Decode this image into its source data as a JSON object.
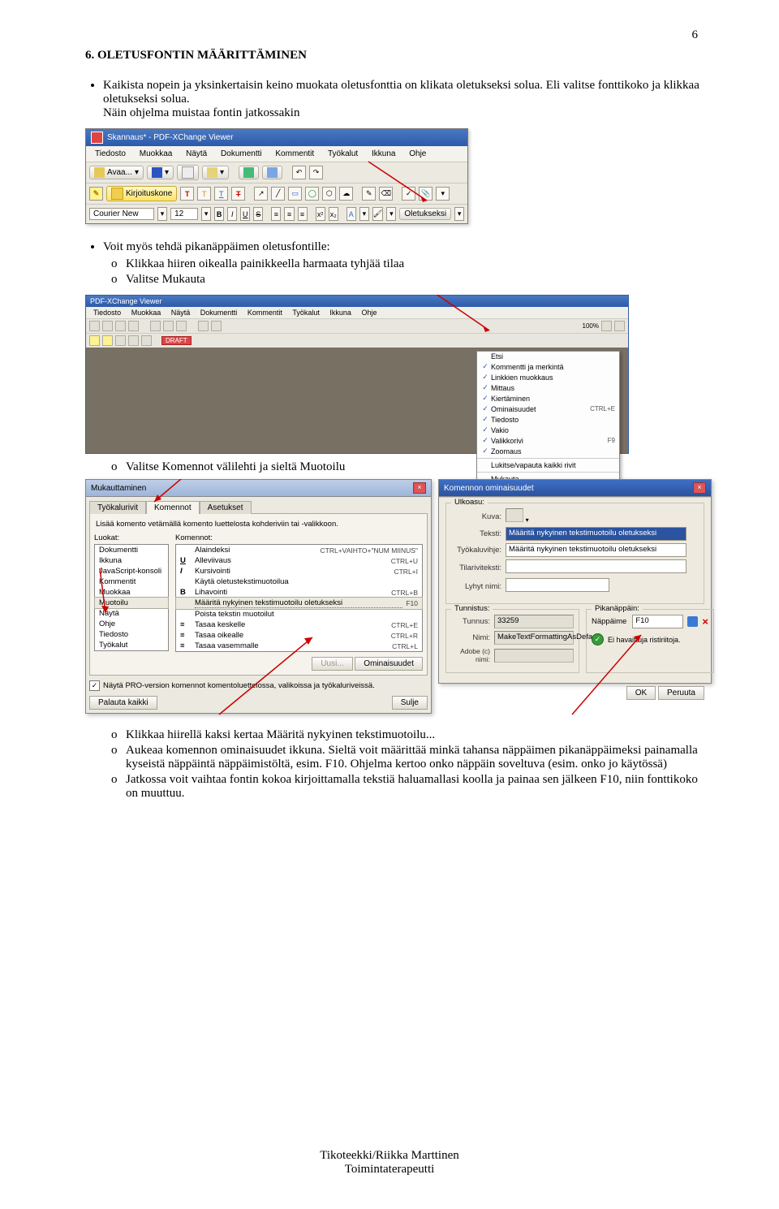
{
  "page_number": "6",
  "h1": "6.  OLETUSFONTIN MÄÄRITTÄMINEN",
  "p1a": "Kaikista nopein ja yksinkertaisin keino muokata oletusfonttia on klikata oletukseksi solua. Eli valitse fonttikoko ja klikkaa oletukseksi solua.",
  "p1b": "Näin ohjelma muistaa fontin jatkossakin",
  "p2": "Voit myös tehdä pikanäppäimen oletusfontille:",
  "p2a": "Klikkaa hiiren oikealla painikkeella harmaata tyhjää tilaa",
  "p2b": "Valitse Mukauta",
  "p3": "Valitse Komennot välilehti ja sieltä Muotoilu",
  "p4a": "Klikkaa hiirellä kaksi kertaa Määritä nykyinen tekstimuotoilu...",
  "p4b": "Aukeaa komennon ominaisuudet ikkuna. Sieltä voit määrittää minkä tahansa näppäimen pikanäppäimeksi painamalla kyseistä näppäintä näppäimistöltä, esim. F10. Ohjelma kertoo onko näppäin soveltuva (esim. onko jo käytössä)",
  "p4c": "Jatkossa voit vaihtaa fontin kokoa kirjoittamalla tekstiä haluamallasi koolla ja painaa sen jälkeen F10, niin fonttikoko on muuttuu.",
  "footer1": "Tikoteekki/Riikka Marttinen",
  "footer2": "Toimintaterapeutti",
  "shot1": {
    "title": "Skannaus* - PDF-XChange Viewer",
    "menu": [
      "Tiedosto",
      "Muokkaa",
      "Näytä",
      "Dokumentti",
      "Kommentit",
      "Työkalut",
      "Ikkuna",
      "Ohje"
    ],
    "open_label": "Avaa...",
    "kirjoituskone": "Kirjoituskone",
    "font_name": "Courier New",
    "font_size": "12",
    "oletukseksi": "Oletukseksi"
  },
  "shot2": {
    "title": "PDF-XChange Viewer",
    "menu": [
      "Tiedosto",
      "Muokkaa",
      "Näytä",
      "Dokumentti",
      "Kommentit",
      "Työkalut",
      "Ikkuna",
      "Ohje"
    ],
    "items": [
      {
        "c": "",
        "l": "Etsi",
        "s": ""
      },
      {
        "c": "✓",
        "l": "Kommentti ja merkintä",
        "s": ""
      },
      {
        "c": "✓",
        "l": "Linkkien muokkaus",
        "s": ""
      },
      {
        "c": "✓",
        "l": "Mittaus",
        "s": ""
      },
      {
        "c": "✓",
        "l": "Kiertäminen",
        "s": ""
      },
      {
        "c": "✓",
        "l": "Ominaisuudet",
        "s": "CTRL+E"
      },
      {
        "c": "✓",
        "l": "Tiedosto",
        "s": ""
      },
      {
        "c": "✓",
        "l": "Vakio",
        "s": ""
      },
      {
        "c": "✓",
        "l": "Valikkorivi",
        "s": "F9"
      },
      {
        "c": "✓",
        "l": "Zoomaus",
        "s": ""
      }
    ],
    "sep1": "Lukitse/vapauta kaikki rivit",
    "mukauta": "Mukauta..."
  },
  "shot3": {
    "dlgA_title": "Mukauttaminen",
    "tabs": [
      "Työkalurivit",
      "Komennot",
      "Asetukset"
    ],
    "hint": "Lisää komento vetämällä komento luettelosta kohderiviin tai -valikkoon.",
    "luokat_lbl": "Luokat:",
    "komennot_lbl": "Komennot:",
    "luokat": [
      "Dokumentti",
      "Ikkuna",
      "JavaScript-konsoli",
      "Kommentit",
      "Muokkaa",
      "Muotoilu",
      "Näytä",
      "Ohje",
      "Tiedosto",
      "Työkalut"
    ],
    "komennot": [
      {
        "t": "Alaindeksi",
        "s": "CTRL+VAIHTO+\"NUM MIINUS\""
      },
      {
        "t": "Alleviivaus",
        "s": "CTRL+U"
      },
      {
        "t": "Kursivointi",
        "s": "CTRL+I"
      },
      {
        "t": "Käytä oletustekstimuotoilua",
        "s": ""
      },
      {
        "t": "Lihavointi",
        "s": "CTRL+B"
      },
      {
        "t": "Määritä nykyinen tekstimuotoilu oletukseksi",
        "s": "F10"
      },
      {
        "t": "Poista tekstin muotoilut",
        "s": ""
      },
      {
        "t": "Tasaa keskelle",
        "s": "CTRL+E"
      },
      {
        "t": "Tasaa oikealle",
        "s": "CTRL+R"
      },
      {
        "t": "Tasaa vasemmalle",
        "s": "CTRL+L"
      }
    ],
    "uusi": "Uusi...",
    "ominaisuudet": "Ominaisuudet",
    "chk": "Näytä PRO-version komennot komentoluettelossa, valikoissa ja työkaluriveissä.",
    "palauta": "Palauta kaikki",
    "sulje": "Sulje",
    "dlgB_title": "Komennon ominaisuudet",
    "grpA": "Ulkoasu:",
    "kuva": "Kuva:",
    "teksti": "Teksti:",
    "tkvihje": "Työkaluvihje:",
    "tilarivi": "Tilariviteksti:",
    "lyhyt": "Lyhyt nimi:",
    "teksti_v": "Määritä nykyinen tekstimuotoilu oletukseksi",
    "tkvihje_v": "Määritä nykyinen tekstimuotoilu oletukseksi",
    "grpB": "Tunnistus:",
    "grpC": "Pikanäppäin:",
    "tunnus": "Tunnus:",
    "tunnus_v": "33259",
    "nimi": "Nimi:",
    "nimi_v": "MakeTextFormattingAsDefau",
    "adobe": "Adobe (c) nimi:",
    "napp": "Näppäime",
    "f10": "F10",
    "noconf": "Ei havaittuja ristiriitoja.",
    "ok": "OK",
    "peruuta": "Peruuta"
  },
  "chart_data": null
}
